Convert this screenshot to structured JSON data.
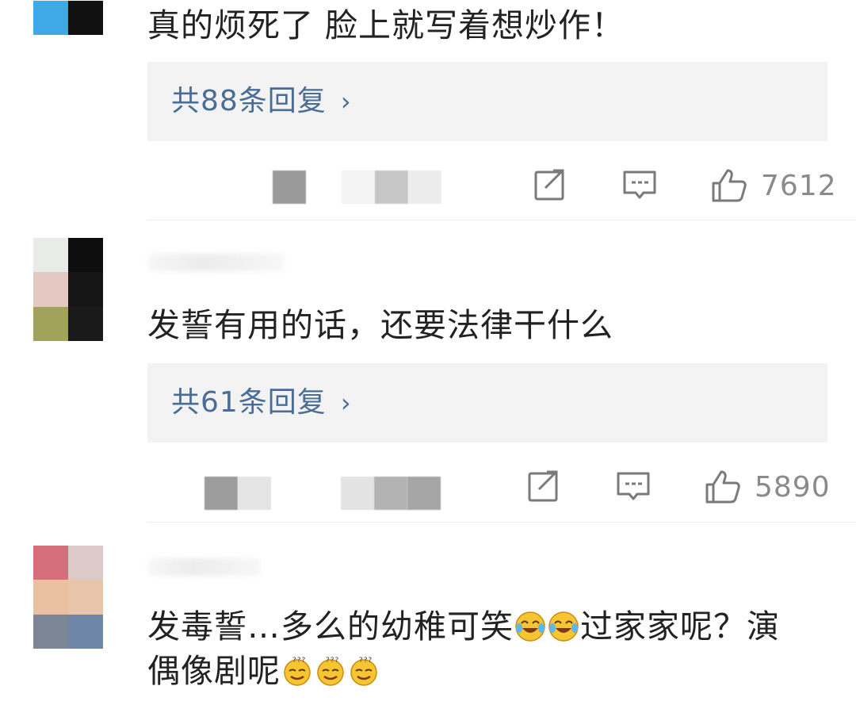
{
  "comments": [
    {
      "text": "真的烦死了 脸上就写着想炒作！",
      "reply_label": "共88条回复",
      "likes": "7612"
    },
    {
      "text": "发誓有用的话，还要法律干什么",
      "reply_label": "共61条回复",
      "likes": "5890"
    },
    {
      "text_line1": "发毒誓…多么的幼稚可笑",
      "text_line1b": "过家家呢？演",
      "text_line2": "偶像剧呢"
    }
  ],
  "icons": {
    "chevron": "›",
    "repost": "share-icon",
    "comment": "comment-icon",
    "like": "thumbs-up-icon"
  },
  "colors": {
    "reply_link": "#4a6d96",
    "reply_bg": "#f3f3f3",
    "meta_gray": "#8a8a8a"
  }
}
